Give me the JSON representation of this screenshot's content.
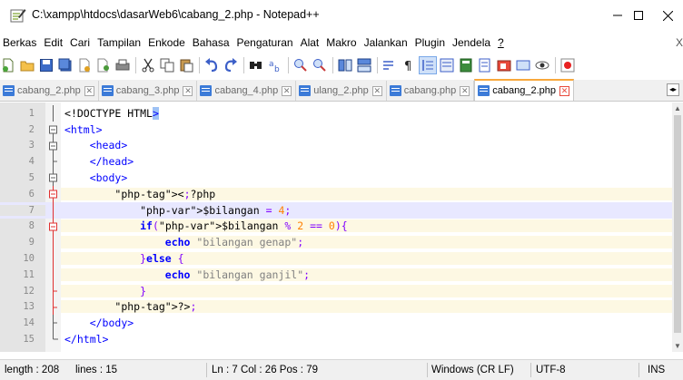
{
  "window": {
    "title": "C:\\xampp\\htdocs\\dasarWeb6\\cabang_2.php - Notepad++",
    "minimize_label": "—",
    "maximize_label": "☐",
    "close_label": "✕"
  },
  "menu": {
    "items": [
      "Berkas",
      "Edit",
      "Cari",
      "Tampilan",
      "Enkode",
      "Bahasa",
      "Pengaturan",
      "Alat",
      "Makro",
      "Jalankan",
      "Plugin",
      "Jendela",
      "?"
    ],
    "overflow": "X"
  },
  "toolbar": {
    "buttons": [
      "new-file-icon",
      "open-file-icon",
      "save-icon",
      "save-all-icon",
      "close-icon",
      "close-all-icon",
      "print-icon",
      "cut-icon",
      "copy-icon",
      "paste-icon",
      "undo-icon",
      "redo-icon",
      "find-icon",
      "replace-icon",
      "zoom-in-icon",
      "zoom-out-icon",
      "sync-vertical-icon",
      "sync-horizontal-icon",
      "word-wrap-icon",
      "show-all-chars-icon",
      "indent-guide-icon",
      "language-icon",
      "doc-map-icon",
      "function-list-icon",
      "folder-workspace-icon",
      "monitoring-icon",
      "record-macro-icon"
    ]
  },
  "tabs": [
    {
      "label": "cabang_2.php",
      "active": false
    },
    {
      "label": "cabang_3.php",
      "active": false
    },
    {
      "label": "cabang_4.php",
      "active": false
    },
    {
      "label": "ulang_2.php",
      "active": false
    },
    {
      "label": "cabang.php",
      "active": false
    },
    {
      "label": "cabang_2.php",
      "active": true
    }
  ],
  "tab_close_glyph": "✕",
  "tab_nav_glyph": "◂▸",
  "editor": {
    "current_line": 7,
    "lines": [
      {
        "n": "1",
        "code": "<!DOCTYPE HTML>"
      },
      {
        "n": "2",
        "code": "<html>"
      },
      {
        "n": "3",
        "code": "    <head>"
      },
      {
        "n": "4",
        "code": "    </head>"
      },
      {
        "n": "5",
        "code": "    <body>"
      },
      {
        "n": "6",
        "code": "        <?php"
      },
      {
        "n": "7",
        "code": "            $bilangan = 4;"
      },
      {
        "n": "8",
        "code": "            if($bilangan % 2 == 0){"
      },
      {
        "n": "9",
        "code": "                echo \"bilangan genap\";"
      },
      {
        "n": "10",
        "code": "            }else {"
      },
      {
        "n": "11",
        "code": "                echo \"bilangan ganjil\";"
      },
      {
        "n": "12",
        "code": "            }"
      },
      {
        "n": "13",
        "code": "        ?>"
      },
      {
        "n": "14",
        "code": "    </body>"
      },
      {
        "n": "15",
        "code": "</html>"
      }
    ]
  },
  "status": {
    "length": "length : 208",
    "lines": "lines : 15",
    "position": "Ln : 7    Col : 26    Pos : 79",
    "eol": "Windows (CR LF)",
    "encoding": "UTF-8",
    "mode": "INS"
  }
}
